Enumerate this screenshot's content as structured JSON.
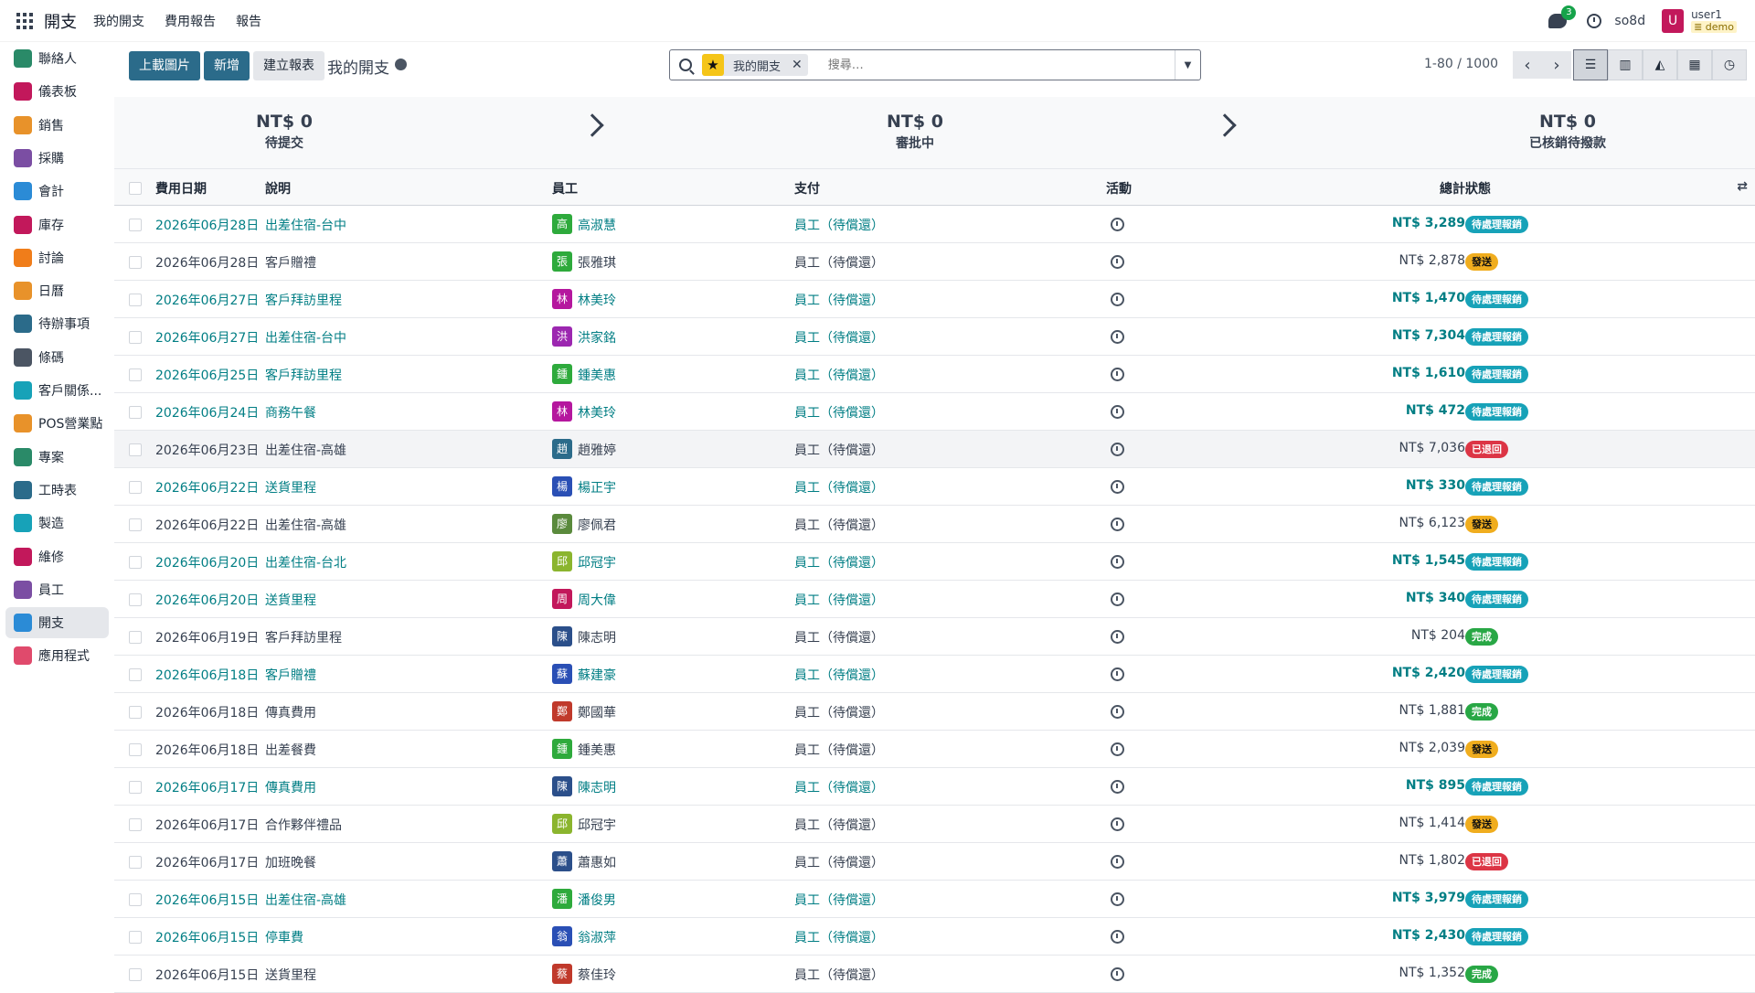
{
  "navbar": {
    "brand": "開支",
    "menu": [
      "我的開支",
      "費用報告",
      "報告"
    ],
    "chat_count": "3",
    "company": "so8d",
    "user_initial": "U",
    "user_name": "user1",
    "db_name": "demo"
  },
  "sidebar": {
    "items": [
      {
        "label": "聯絡人",
        "color": "#2a8a68"
      },
      {
        "label": "儀表板",
        "color": "#c2185b"
      },
      {
        "label": "銷售",
        "color": "#e8922a"
      },
      {
        "label": "採購",
        "color": "#7b4ea3"
      },
      {
        "label": "會計",
        "color": "#2b8bd6"
      },
      {
        "label": "庫存",
        "color": "#c2185b"
      },
      {
        "label": "討論",
        "color": "#f07d1a"
      },
      {
        "label": "日曆",
        "color": "#e8922a"
      },
      {
        "label": "待辦事項",
        "color": "#2b6b8a"
      },
      {
        "label": "條碼",
        "color": "#4b5563"
      },
      {
        "label": "客戶關係...",
        "color": "#17a2b8"
      },
      {
        "label": "POS營業點",
        "color": "#e8922a"
      },
      {
        "label": "專案",
        "color": "#2a8a68"
      },
      {
        "label": "工時表",
        "color": "#2b6b8a"
      },
      {
        "label": "製造",
        "color": "#17a2b8"
      },
      {
        "label": "維修",
        "color": "#c2185b"
      },
      {
        "label": "員工",
        "color": "#7b4ea3"
      },
      {
        "label": "開支",
        "color": "#2b8bd6"
      },
      {
        "label": "應用程式",
        "color": "#e04a6c"
      }
    ]
  },
  "control": {
    "upload": "上載圖片",
    "new": "新增",
    "create_report": "建立報表",
    "title": "我的開支",
    "facet": "我的開支",
    "search_placeholder": "搜尋…",
    "pager": "1-80 / 1000"
  },
  "stages": [
    {
      "amount": "NT$ 0",
      "label": "待提交"
    },
    {
      "amount": "NT$ 0",
      "label": "審批中"
    },
    {
      "amount": "NT$ 0",
      "label": "已核銷待撥款"
    }
  ],
  "table": {
    "headers": {
      "date": "費用日期",
      "desc": "說明",
      "employee": "員工",
      "payment": "支付",
      "activity": "活動",
      "total": "總計",
      "status": "狀態"
    },
    "rows": [
      {
        "date": "2026年06月28日",
        "desc": "出差住宿-台中",
        "initial": "高",
        "employee": "高淑慧",
        "av": "#2eaa3c",
        "payment": "員工（待償還）",
        "total": "NT$ 3,289",
        "status": "待處理報銷",
        "kind": "info",
        "link": true
      },
      {
        "date": "2026年06月28日",
        "desc": "客戶贈禮",
        "initial": "張",
        "employee": "張雅琪",
        "av": "#2eaa3c",
        "payment": "員工（待償還）",
        "total": "NT$ 2,878",
        "status": "發送",
        "kind": "warn",
        "link": false
      },
      {
        "date": "2026年06月27日",
        "desc": "客戶拜訪里程",
        "initial": "林",
        "employee": "林美玲",
        "av": "#b5179e",
        "payment": "員工（待償還）",
        "total": "NT$ 1,470",
        "status": "待處理報銷",
        "kind": "info",
        "link": true
      },
      {
        "date": "2026年06月27日",
        "desc": "出差住宿-台中",
        "initial": "洪",
        "employee": "洪家銘",
        "av": "#9c27b0",
        "payment": "員工（待償還）",
        "total": "NT$ 7,304",
        "status": "待處理報銷",
        "kind": "info",
        "link": true
      },
      {
        "date": "2026年06月25日",
        "desc": "客戶拜訪里程",
        "initial": "鍾",
        "employee": "鍾美惠",
        "av": "#2eaa3c",
        "payment": "員工（待償還）",
        "total": "NT$ 1,610",
        "status": "待處理報銷",
        "kind": "info",
        "link": true
      },
      {
        "date": "2026年06月24日",
        "desc": "商務午餐",
        "initial": "林",
        "employee": "林美玲",
        "av": "#b5179e",
        "payment": "員工（待償還）",
        "total": "NT$ 472",
        "status": "待處理報銷",
        "kind": "info",
        "link": true
      },
      {
        "date": "2026年06月23日",
        "desc": "出差住宿-高雄",
        "initial": "趙",
        "employee": "趙雅婷",
        "av": "#2b6b8a",
        "payment": "員工（待償還）",
        "total": "NT$ 7,036",
        "status": "已退回",
        "kind": "danger",
        "link": false
      },
      {
        "date": "2026年06月22日",
        "desc": "送貨里程",
        "initial": "楊",
        "employee": "楊正宇",
        "av": "#2a4fb5",
        "payment": "員工（待償還）",
        "total": "NT$ 330",
        "status": "待處理報銷",
        "kind": "info",
        "link": true
      },
      {
        "date": "2026年06月22日",
        "desc": "出差住宿-高雄",
        "initial": "廖",
        "employee": "廖佩君",
        "av": "#5a8a3c",
        "payment": "員工（待償還）",
        "total": "NT$ 6,123",
        "status": "發送",
        "kind": "warn",
        "link": false
      },
      {
        "date": "2026年06月20日",
        "desc": "出差住宿-台北",
        "initial": "邱",
        "employee": "邱冠宇",
        "av": "#8bb52e",
        "payment": "員工（待償還）",
        "total": "NT$ 1,545",
        "status": "待處理報銷",
        "kind": "info",
        "link": true
      },
      {
        "date": "2026年06月20日",
        "desc": "送貨里程",
        "initial": "周",
        "employee": "周大偉",
        "av": "#c2185b",
        "payment": "員工（待償還）",
        "total": "NT$ 340",
        "status": "待處理報銷",
        "kind": "info",
        "link": true
      },
      {
        "date": "2026年06月19日",
        "desc": "客戶拜訪里程",
        "initial": "陳",
        "employee": "陳志明",
        "av": "#2b4f8a",
        "payment": "員工（待償還）",
        "total": "NT$ 204",
        "status": "完成",
        "kind": "success",
        "link": false
      },
      {
        "date": "2026年06月18日",
        "desc": "客戶贈禮",
        "initial": "蘇",
        "employee": "蘇建豪",
        "av": "#2a4fb5",
        "payment": "員工（待償還）",
        "total": "NT$ 2,420",
        "status": "待處理報銷",
        "kind": "info",
        "link": true
      },
      {
        "date": "2026年06月18日",
        "desc": "傳真費用",
        "initial": "鄭",
        "employee": "鄭國華",
        "av": "#c0392b",
        "payment": "員工（待償還）",
        "total": "NT$ 1,881",
        "status": "完成",
        "kind": "success",
        "link": false
      },
      {
        "date": "2026年06月18日",
        "desc": "出差餐費",
        "initial": "鍾",
        "employee": "鍾美惠",
        "av": "#2eaa3c",
        "payment": "員工（待償還）",
        "total": "NT$ 2,039",
        "status": "發送",
        "kind": "warn",
        "link": false
      },
      {
        "date": "2026年06月17日",
        "desc": "傳真費用",
        "initial": "陳",
        "employee": "陳志明",
        "av": "#2b4f8a",
        "payment": "員工（待償還）",
        "total": "NT$ 895",
        "status": "待處理報銷",
        "kind": "info",
        "link": true
      },
      {
        "date": "2026年06月17日",
        "desc": "合作夥伴禮品",
        "initial": "邱",
        "employee": "邱冠宇",
        "av": "#8bb52e",
        "payment": "員工（待償還）",
        "total": "NT$ 1,414",
        "status": "發送",
        "kind": "warn",
        "link": false
      },
      {
        "date": "2026年06月17日",
        "desc": "加班晚餐",
        "initial": "蕭",
        "employee": "蕭惠如",
        "av": "#2b4f8a",
        "payment": "員工（待償還）",
        "total": "NT$ 1,802",
        "status": "已退回",
        "kind": "danger",
        "link": false
      },
      {
        "date": "2026年06月15日",
        "desc": "出差住宿-高雄",
        "initial": "潘",
        "employee": "潘俊男",
        "av": "#2eaa3c",
        "payment": "員工（待償還）",
        "total": "NT$ 3,979",
        "status": "待處理報銷",
        "kind": "info",
        "link": true
      },
      {
        "date": "2026年06月15日",
        "desc": "停車費",
        "initial": "翁",
        "employee": "翁淑萍",
        "av": "#2a4fb5",
        "payment": "員工（待償還）",
        "total": "NT$ 2,430",
        "status": "待處理報銷",
        "kind": "info",
        "link": true
      },
      {
        "date": "2026年06月15日",
        "desc": "送貨里程",
        "initial": "蔡",
        "employee": "蔡佳玲",
        "av": "#c0392b",
        "payment": "員工（待償還）",
        "total": "NT$ 1,352",
        "status": "完成",
        "kind": "success",
        "link": false
      }
    ]
  }
}
